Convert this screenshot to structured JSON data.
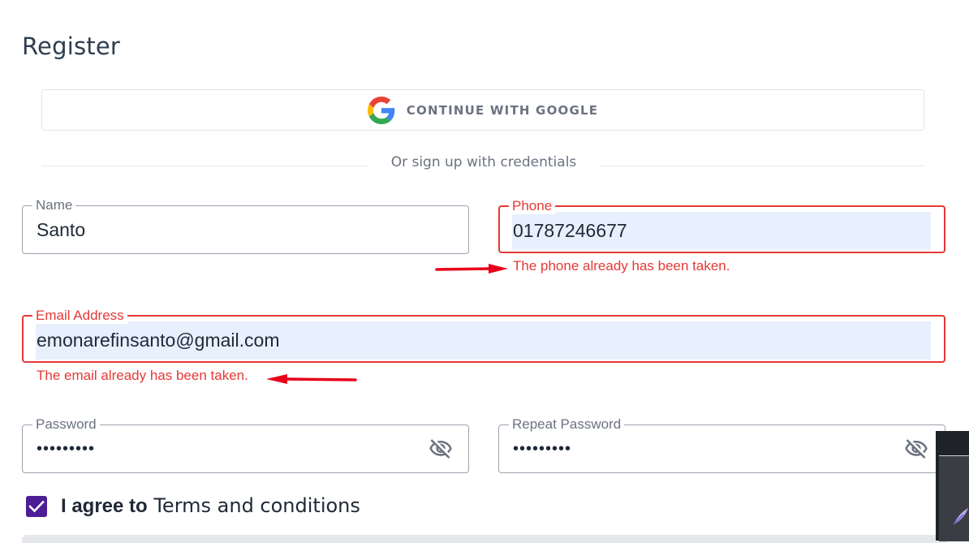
{
  "page": {
    "title": "Register"
  },
  "google": {
    "label": "CONTINUE WITH GOOGLE",
    "icon": "google-icon"
  },
  "divider": {
    "text": "Or sign up with credentials"
  },
  "form": {
    "name": {
      "label": "Name",
      "value": "Santo"
    },
    "phone": {
      "label": "Phone",
      "value": "01787246677",
      "error": "The phone already has been taken."
    },
    "email": {
      "label": "Email Address",
      "value": "emonarefinsanto@gmail.com",
      "error": "The email already has been taken."
    },
    "password": {
      "label": "Password",
      "value": "•••••••••",
      "icon": "eye-off-icon"
    },
    "repeat_password": {
      "label": "Repeat Password",
      "value": "•••••••••",
      "icon": "eye-off-icon"
    },
    "agree": {
      "prefix": "I agree to",
      "link": "Terms and conditions",
      "checked": true
    }
  },
  "colors": {
    "error": "#e53935",
    "accent": "#4c1d95",
    "autofill": "#e8f0fe",
    "annotation": "#e8001a"
  }
}
